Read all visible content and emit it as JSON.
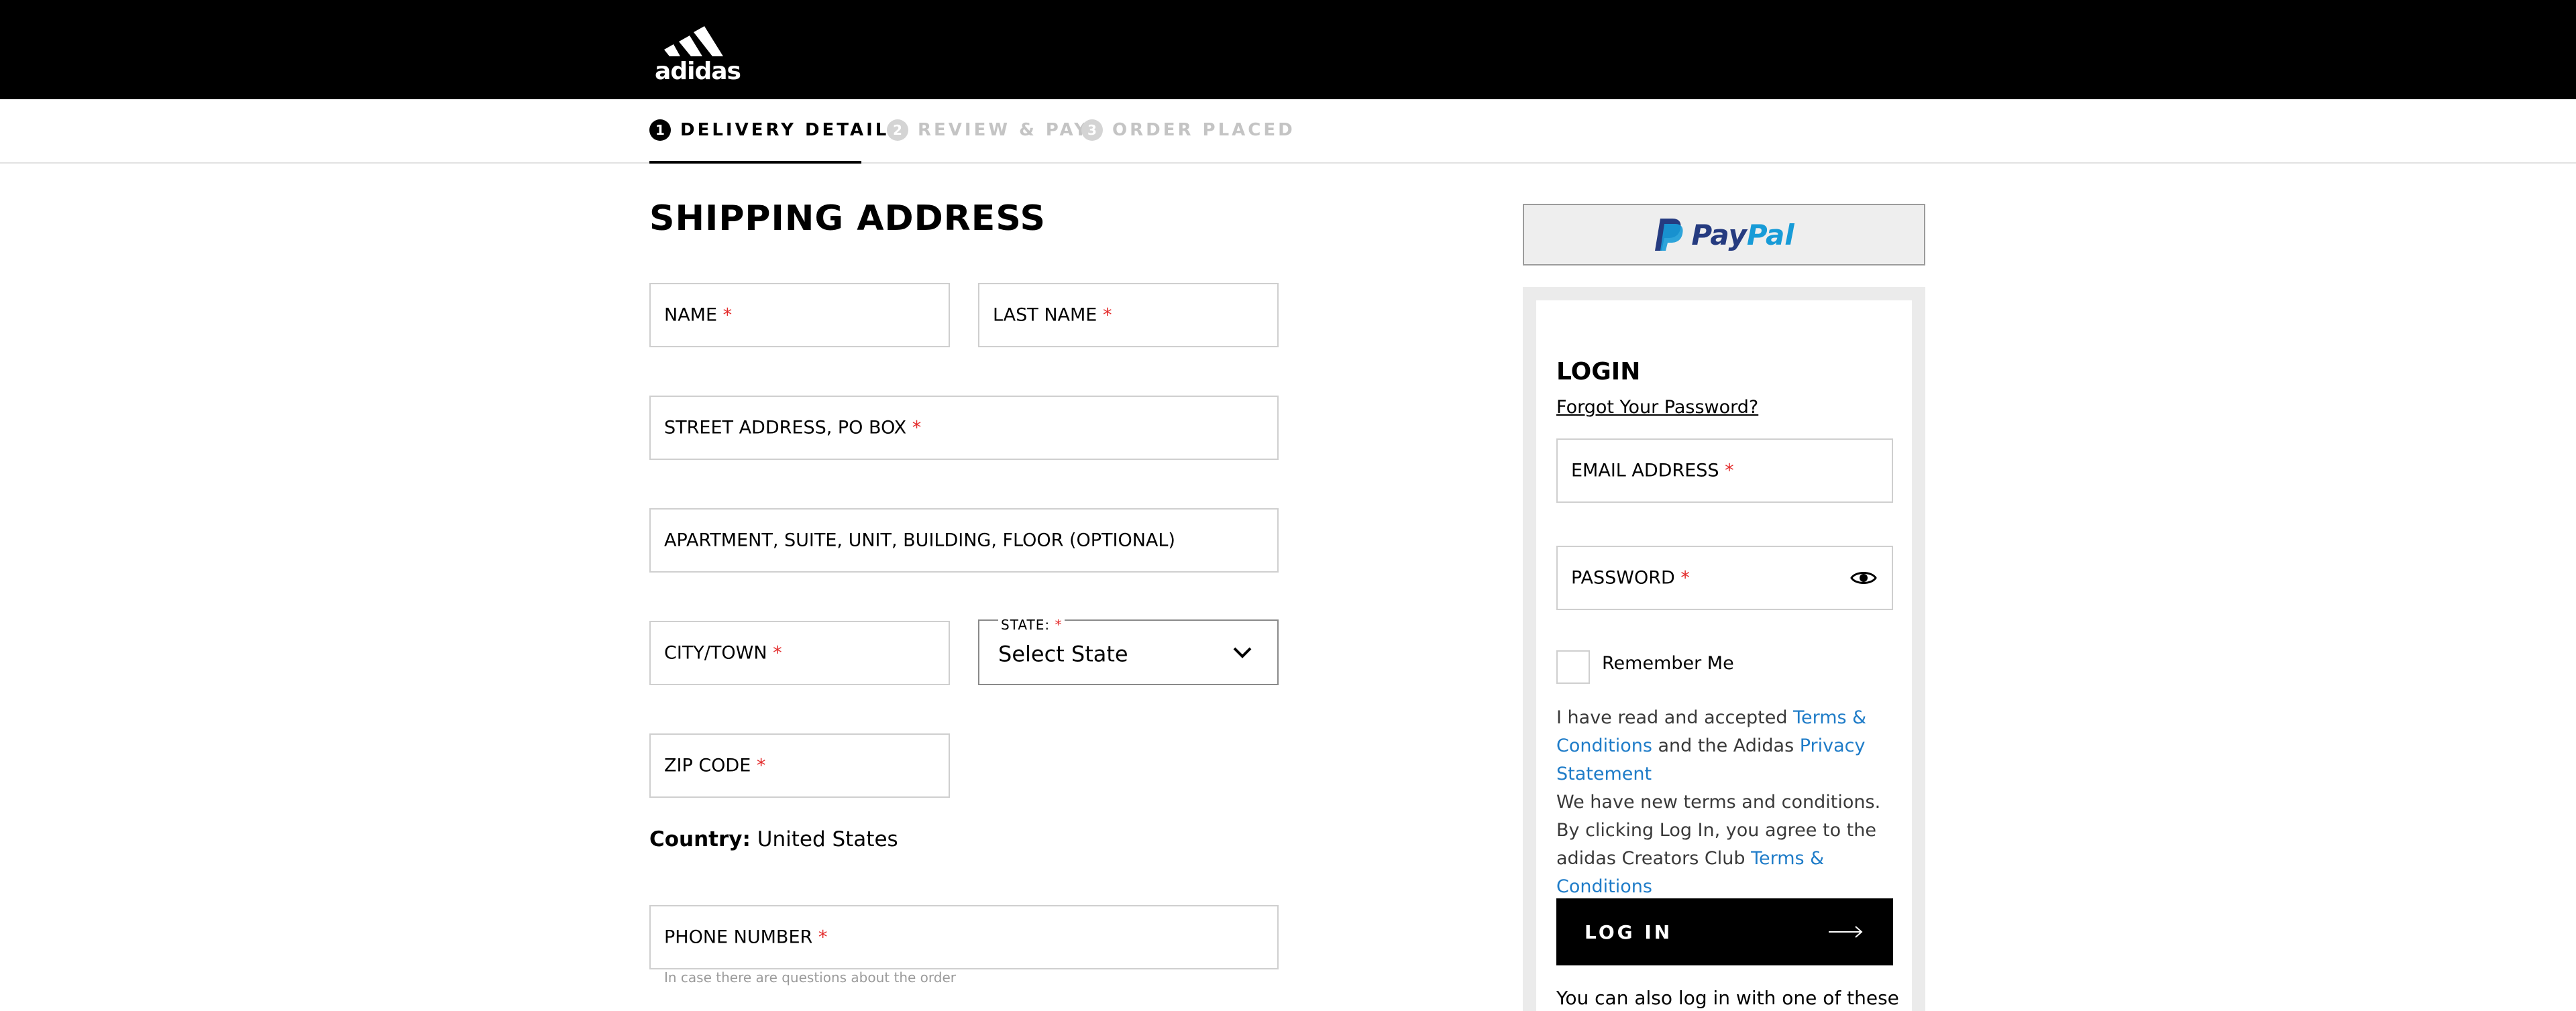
{
  "header": {
    "logo_text": "adidas",
    "steps": [
      {
        "num": "1",
        "label": "DELIVERY DETAILS"
      },
      {
        "num": "2",
        "label": "REVIEW & PAY"
      },
      {
        "num": "3",
        "label": "ORDER PLACED"
      }
    ]
  },
  "shipping": {
    "title": "SHIPPING ADDRESS",
    "fields": {
      "name": "NAME",
      "last_name": "LAST NAME",
      "street": "STREET ADDRESS, PO BOX",
      "apartment": "APARTMENT, SUITE, UNIT, BUILDING, FLOOR (OPTIONAL)",
      "city": "CITY/TOWN",
      "state_label": "STATE:",
      "state_value": "Select State",
      "zip": "ZIP CODE",
      "phone": "PHONE NUMBER"
    },
    "required_mark": "*",
    "country_label": "Country:",
    "country_value": "United States",
    "phone_hint": "In case there are questions about the order"
  },
  "paypal": {
    "pay": "Pay",
    "pal": "Pal"
  },
  "login": {
    "title": "LOGIN",
    "forgot": "Forgot Your Password?",
    "email": "EMAIL ADDRESS",
    "password": "PASSWORD",
    "remember": "Remember Me",
    "terms_1": "I have read and accepted ",
    "terms_link_1": "Terms & Conditions",
    "terms_2": " and the Adidas ",
    "terms_link_2": "Privacy Statement",
    "terms_3": "We have new terms and conditions. By clicking Log In, you agree to the adidas Creators Club ",
    "terms_link_3": "Terms & Conditions",
    "button": "LOG IN",
    "also": "You can also log in with one of these"
  },
  "colors": {
    "required": "#e32b2b",
    "link": "#1f7cc8",
    "paypal_dark": "#253b80",
    "paypal_light": "#179bd7"
  }
}
